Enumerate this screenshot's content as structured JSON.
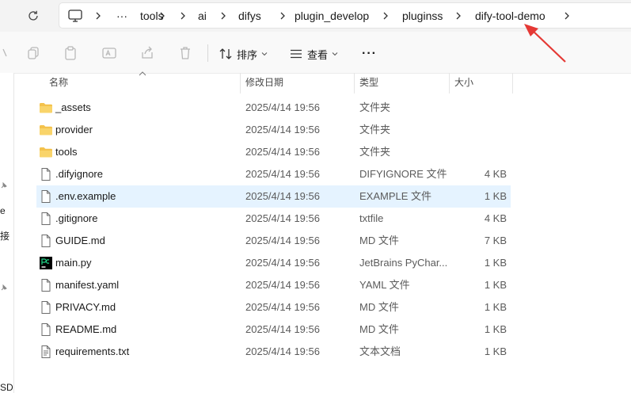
{
  "address_bar": {
    "crumbs": [
      "···",
      "tools",
      "ai",
      "difys",
      "plugin_develop",
      "pluginss",
      "dify-tool-demo"
    ]
  },
  "toolbar": {
    "sort_label": "排序",
    "view_label": "查看",
    "more_label": "···"
  },
  "left_nav": {
    "fragments": [
      "e",
      "接",
      "SD"
    ]
  },
  "columns": {
    "name": "名称",
    "date": "修改日期",
    "type": "类型",
    "size": "大小"
  },
  "files": [
    {
      "name": "_assets",
      "date": "2025/4/14 19:56",
      "type": "文件夹",
      "size": "",
      "kind": "folder"
    },
    {
      "name": "provider",
      "date": "2025/4/14 19:56",
      "type": "文件夹",
      "size": "",
      "kind": "folder"
    },
    {
      "name": "tools",
      "date": "2025/4/14 19:56",
      "type": "文件夹",
      "size": "",
      "kind": "folder"
    },
    {
      "name": ".difyignore",
      "date": "2025/4/14 19:56",
      "type": "DIFYIGNORE 文件",
      "size": "4 KB",
      "kind": "file"
    },
    {
      "name": ".env.example",
      "date": "2025/4/14 19:56",
      "type": "EXAMPLE 文件",
      "size": "1 KB",
      "kind": "file",
      "selected": true
    },
    {
      "name": ".gitignore",
      "date": "2025/4/14 19:56",
      "type": "txtfile",
      "size": "4 KB",
      "kind": "file"
    },
    {
      "name": "GUIDE.md",
      "date": "2025/4/14 19:56",
      "type": "MD 文件",
      "size": "7 KB",
      "kind": "file"
    },
    {
      "name": "main.py",
      "date": "2025/4/14 19:56",
      "type": "JetBrains PyChar...",
      "size": "1 KB",
      "kind": "pycharm"
    },
    {
      "name": "manifest.yaml",
      "date": "2025/4/14 19:56",
      "type": "YAML 文件",
      "size": "1 KB",
      "kind": "file"
    },
    {
      "name": "PRIVACY.md",
      "date": "2025/4/14 19:56",
      "type": "MD 文件",
      "size": "1 KB",
      "kind": "file"
    },
    {
      "name": "README.md",
      "date": "2025/4/14 19:56",
      "type": "MD 文件",
      "size": "1 KB",
      "kind": "file"
    },
    {
      "name": "requirements.txt",
      "date": "2025/4/14 19:56",
      "type": "文本文档",
      "size": "1 KB",
      "kind": "text"
    }
  ],
  "colors": {
    "selection": "#e5f3ff",
    "folder": "#f4c24c",
    "annotation_arrow": "#e53935"
  }
}
